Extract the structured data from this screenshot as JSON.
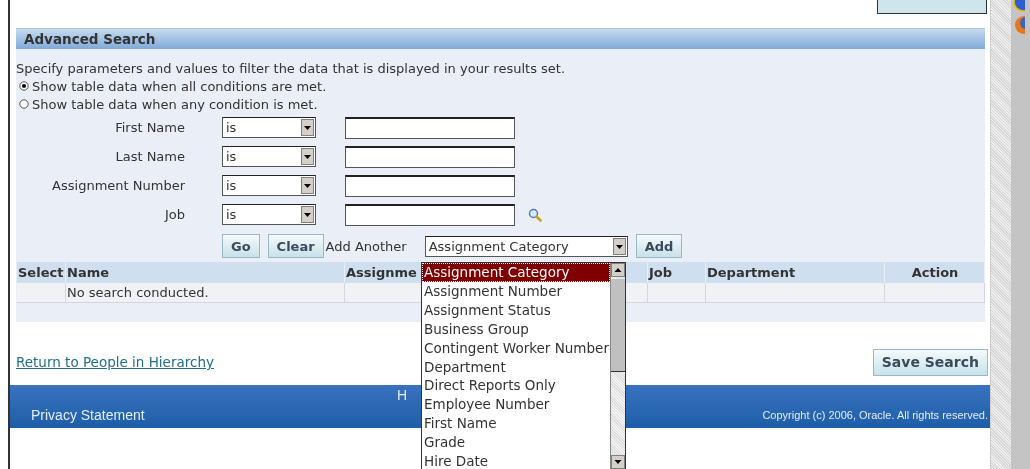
{
  "panel": {
    "title": "Advanced Search",
    "description": "Specify parameters and values to filter the data that is displayed in your results set.",
    "match_options": [
      {
        "label": "Show table data when all conditions are met.",
        "selected": true
      },
      {
        "label": "Show table data when any condition is met.",
        "selected": false
      }
    ],
    "criteria": [
      {
        "kind": "text",
        "label": "First Name",
        "operator": "is"
      },
      {
        "kind": "text",
        "label": "Last Name",
        "operator": "is"
      },
      {
        "kind": "text",
        "label": "Assignment Number",
        "operator": "is"
      },
      {
        "kind": "lookup",
        "label": "Job",
        "operator": "is"
      }
    ],
    "go_button": "Go",
    "clear_button": "Clear",
    "add_another_label": "Add Another",
    "add_another_value": "Assignment Category",
    "add_button": "Add",
    "table": {
      "columns": [
        "Select",
        "Name",
        "Assignme",
        "Job",
        "Department",
        "Action"
      ],
      "empty_message": "No search conducted."
    },
    "dropdown_options": [
      {
        "label": "Assignment Category",
        "selected": true
      },
      {
        "label": "Assignment Number",
        "selected": false
      },
      {
        "label": "Assignment Status",
        "selected": false
      },
      {
        "label": "Business Group",
        "selected": false
      },
      {
        "label": "Contingent Worker Number",
        "selected": false
      },
      {
        "label": "Department",
        "selected": false
      },
      {
        "label": "Direct Reports Only",
        "selected": false
      },
      {
        "label": "Employee Number",
        "selected": false
      },
      {
        "label": "First Name",
        "selected": false
      },
      {
        "label": "Grade",
        "selected": false
      },
      {
        "label": "Hire Date",
        "selected": false
      }
    ]
  },
  "return_link": "Return to People in Hierarchy",
  "save_button": "Save Search",
  "footer": {
    "partial_link": "H",
    "privacy_link": "Privacy Statement",
    "copyright": "Copyright (c) 2006, Oracle. All rights reserved."
  }
}
